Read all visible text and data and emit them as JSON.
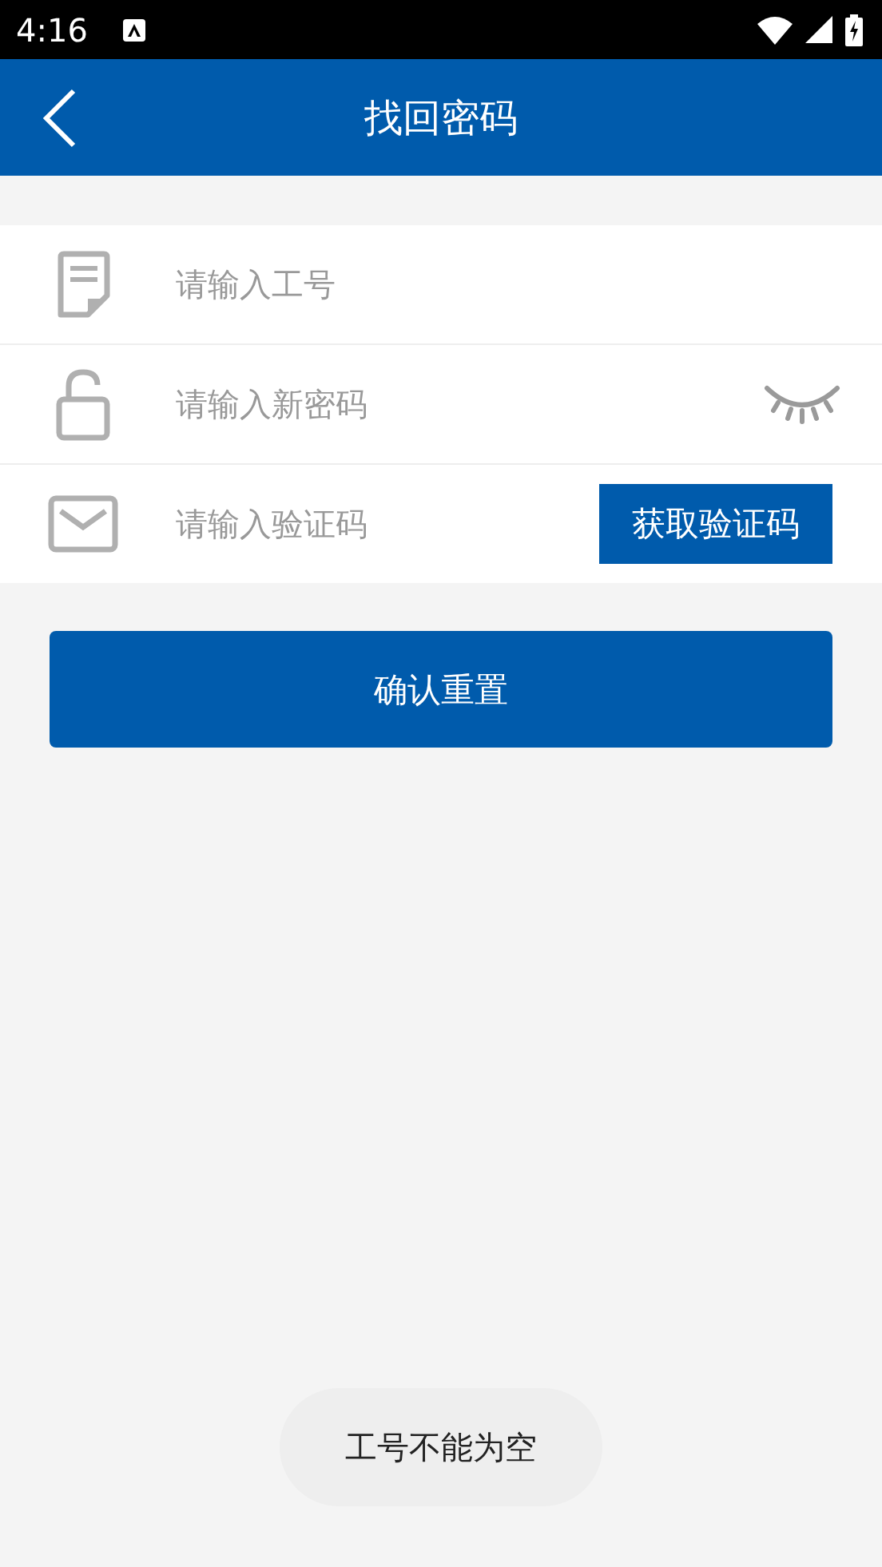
{
  "status_bar": {
    "time": "4:16"
  },
  "header": {
    "title": "找回密码"
  },
  "fields": [
    {
      "kind": "id",
      "placeholder": "请输入工号"
    },
    {
      "kind": "password",
      "placeholder": "请输入新密码"
    },
    {
      "kind": "code",
      "placeholder": "请输入验证码",
      "button": "获取验证码"
    }
  ],
  "submit": "确认重置",
  "toast": "工号不能为空"
}
